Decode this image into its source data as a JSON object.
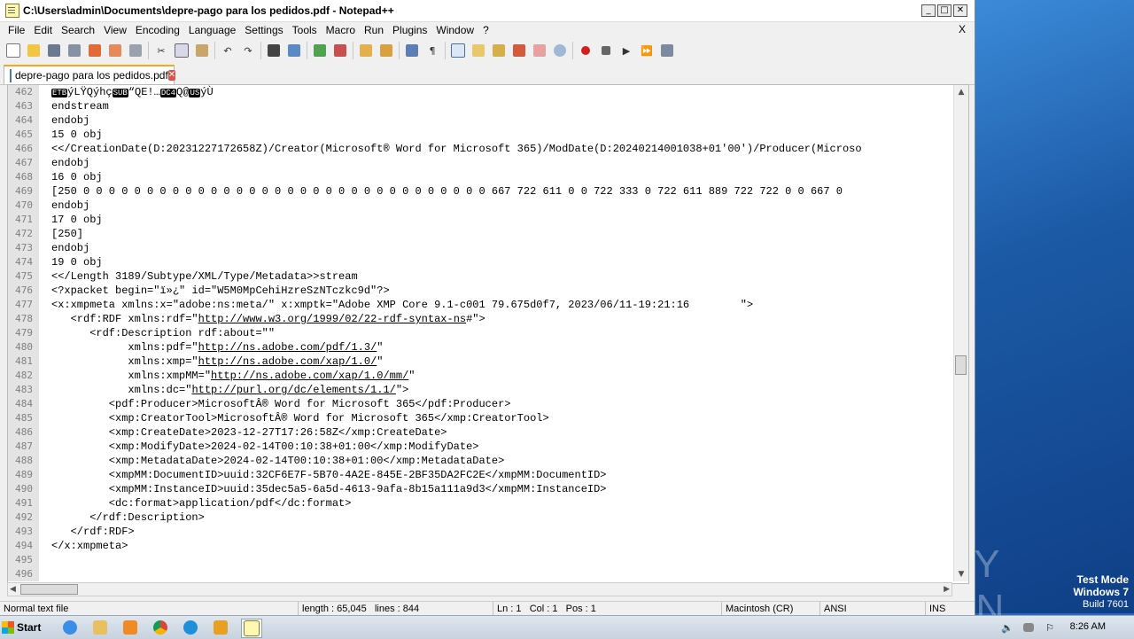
{
  "window": {
    "title": "C:\\Users\\admin\\Documents\\depre-pago para los pedidos.pdf - Notepad++"
  },
  "menu": [
    "File",
    "Edit",
    "Search",
    "View",
    "Encoding",
    "Language",
    "Settings",
    "Tools",
    "Macro",
    "Run",
    "Plugins",
    "Window",
    "?"
  ],
  "menu_close": "X",
  "tab": {
    "label": "depre-pago para los pedidos.pdf"
  },
  "editor": {
    "lines": [
      {
        "n": "462",
        "t": ""
      },
      {
        "n": "463",
        "t": "endstream"
      },
      {
        "n": "464",
        "t": "endobj"
      },
      {
        "n": "465",
        "t": "15 0 obj"
      },
      {
        "n": "466",
        "t": "<</CreationDate(D:20231227172658Z)/Creator(Microsoft® Word for Microsoft 365)/ModDate(D:20240214001038+01'00')/Producer(Microso"
      },
      {
        "n": "467",
        "t": "endobj"
      },
      {
        "n": "468",
        "t": "16 0 obj"
      },
      {
        "n": "469",
        "t": "[250 0 0 0 0 0 0 0 0 0 0 0 0 0 0 0 0 0 0 0 0 0 0 0 0 0 0 0 0 0 0 0 0 667 722 611 0 0 722 333 0 722 611 889 722 722 0 0 667 0"
      },
      {
        "n": "470",
        "t": "endobj"
      },
      {
        "n": "471",
        "t": "17 0 obj"
      },
      {
        "n": "472",
        "t": "[250]"
      },
      {
        "n": "473",
        "t": "endobj"
      },
      {
        "n": "474",
        "t": "19 0 obj"
      },
      {
        "n": "475",
        "t": "<</Length 3189/Subtype/XML/Type/Metadata>>stream"
      },
      {
        "n": "476",
        "t": "<?xpacket begin=\"ï»¿\" id=\"W5M0MpCehiHzreSzNTczkc9d\"?>"
      },
      {
        "n": "477",
        "t": "<x:xmpmeta xmlns:x=\"adobe:ns:meta/\" x:xmptk=\"Adobe XMP Core 9.1-c001 79.675d0f7, 2023/06/11-19:21:16        \">"
      },
      {
        "n": "478",
        "pre": "   <rdf:RDF xmlns:rdf=\"",
        "link": "http://www.w3.org/1999/02/22-rdf-syntax-ns",
        "post": "#\">"
      },
      {
        "n": "479",
        "t": "      <rdf:Description rdf:about=\"\""
      },
      {
        "n": "480",
        "pre": "            xmlns:pdf=\"",
        "link": "http://ns.adobe.com/pdf/1.3/",
        "post": "\""
      },
      {
        "n": "481",
        "pre": "            xmlns:xmp=\"",
        "link": "http://ns.adobe.com/xap/1.0/",
        "post": "\""
      },
      {
        "n": "482",
        "pre": "            xmlns:xmpMM=\"",
        "link": "http://ns.adobe.com/xap/1.0/mm/",
        "post": "\""
      },
      {
        "n": "483",
        "pre": "            xmlns:dc=\"",
        "link": "http://purl.org/dc/elements/1.1/",
        "post": "\">"
      },
      {
        "n": "484",
        "t": "         <pdf:Producer>MicrosoftÂ® Word for Microsoft 365</pdf:Producer>"
      },
      {
        "n": "485",
        "t": "         <xmp:CreatorTool>MicrosoftÂ® Word for Microsoft 365</xmp:CreatorTool>"
      },
      {
        "n": "486",
        "t": "         <xmp:CreateDate>2023-12-27T17:26:58Z</xmp:CreateDate>"
      },
      {
        "n": "487",
        "t": "         <xmp:ModifyDate>2024-02-14T00:10:38+01:00</xmp:ModifyDate>"
      },
      {
        "n": "488",
        "t": "         <xmp:MetadataDate>2024-02-14T00:10:38+01:00</xmp:MetadataDate>"
      },
      {
        "n": "489",
        "t": "         <xmpMM:DocumentID>uuid:32CF6E7F-5B70-4A2E-845E-2BF35DA2FC2E</xmpMM:DocumentID>"
      },
      {
        "n": "490",
        "t": "         <xmpMM:InstanceID>uuid:35dec5a5-6a5d-4613-9afa-8b15a111a9d3</xmpMM:InstanceID>"
      },
      {
        "n": "491",
        "t": "         <dc:format>application/pdf</dc:format>"
      },
      {
        "n": "492",
        "t": "      </rdf:Description>"
      },
      {
        "n": "493",
        "t": "   </rdf:RDF>"
      },
      {
        "n": "494",
        "t": "</x:xmpmeta>"
      },
      {
        "n": "495",
        "t": ""
      },
      {
        "n": "496",
        "t": ""
      }
    ],
    "line462": {
      "c1": "ETB",
      "a": "ýLŸQýhç",
      "c2": "SUB",
      "b": "“QE!…",
      "c3": "DC4",
      "c": "Q@",
      "c4": "US",
      "d": "ýÙ"
    }
  },
  "status": {
    "filetype": "Normal text file",
    "length": "length : 65,045",
    "lines": "lines : 844",
    "ln": "Ln : 1",
    "col": "Col : 1",
    "pos": "Pos : 1",
    "eol": "Macintosh (CR)",
    "encoding": "ANSI",
    "ins": "INS"
  },
  "taskbar": {
    "start": "Start",
    "clock": "8:26 AM"
  },
  "watermark": {
    "text": "ANY RUN"
  },
  "sysinfo": {
    "mode": "Test Mode",
    "os": "Windows 7",
    "build": "Build 7601"
  },
  "colors": {
    "tab_accent": "#f5a623",
    "gutter": "#e4e4e4",
    "link": "#000000"
  },
  "toolbar_icons": [
    "new-icon",
    "open-icon",
    "save-icon",
    "save-all-icon",
    "close-icon",
    "close-all-icon",
    "print-icon",
    "cut-icon",
    "copy-icon",
    "paste-icon",
    "undo-icon",
    "redo-icon",
    "find-icon",
    "replace-icon",
    "zoom-in-icon",
    "zoom-out-icon",
    "sync-v-icon",
    "sync-h-icon",
    "wrap-icon",
    "all-chars-icon",
    "indent-guide-icon",
    "udl-icon",
    "doc-map-icon",
    "function-list-icon",
    "folder-as-workspace-icon",
    "monitor-icon",
    "record-macro-icon",
    "stop-macro-icon",
    "play-macro-icon",
    "run-macro-multiple-icon",
    "save-macro-icon"
  ]
}
